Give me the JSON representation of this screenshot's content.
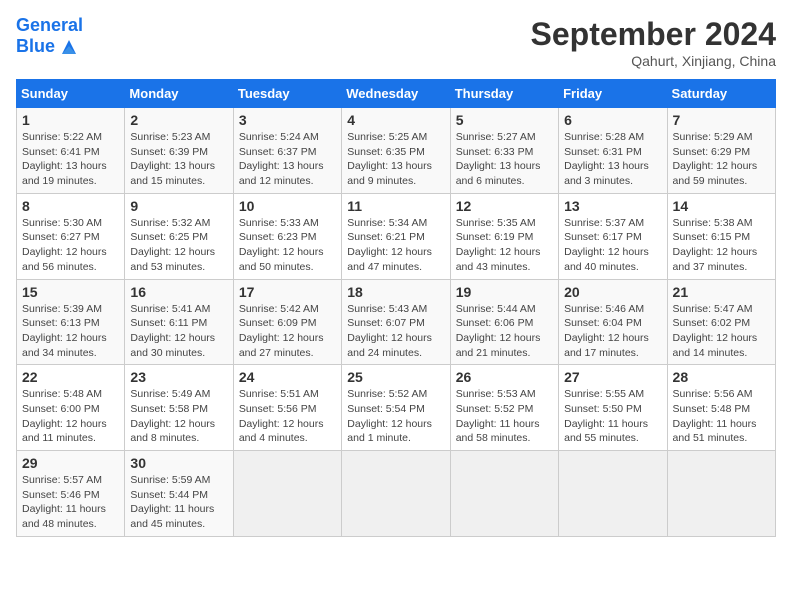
{
  "header": {
    "logo_line1": "General",
    "logo_line2": "Blue",
    "month": "September 2024",
    "location": "Qahurt, Xinjiang, China"
  },
  "days_of_week": [
    "Sunday",
    "Monday",
    "Tuesday",
    "Wednesday",
    "Thursday",
    "Friday",
    "Saturday"
  ],
  "weeks": [
    [
      {
        "day": "1",
        "sunrise": "5:22 AM",
        "sunset": "6:41 PM",
        "daylight": "13 hours and 19 minutes."
      },
      {
        "day": "2",
        "sunrise": "5:23 AM",
        "sunset": "6:39 PM",
        "daylight": "13 hours and 15 minutes."
      },
      {
        "day": "3",
        "sunrise": "5:24 AM",
        "sunset": "6:37 PM",
        "daylight": "13 hours and 12 minutes."
      },
      {
        "day": "4",
        "sunrise": "5:25 AM",
        "sunset": "6:35 PM",
        "daylight": "13 hours and 9 minutes."
      },
      {
        "day": "5",
        "sunrise": "5:27 AM",
        "sunset": "6:33 PM",
        "daylight": "13 hours and 6 minutes."
      },
      {
        "day": "6",
        "sunrise": "5:28 AM",
        "sunset": "6:31 PM",
        "daylight": "13 hours and 3 minutes."
      },
      {
        "day": "7",
        "sunrise": "5:29 AM",
        "sunset": "6:29 PM",
        "daylight": "12 hours and 59 minutes."
      }
    ],
    [
      {
        "day": "8",
        "sunrise": "5:30 AM",
        "sunset": "6:27 PM",
        "daylight": "12 hours and 56 minutes."
      },
      {
        "day": "9",
        "sunrise": "5:32 AM",
        "sunset": "6:25 PM",
        "daylight": "12 hours and 53 minutes."
      },
      {
        "day": "10",
        "sunrise": "5:33 AM",
        "sunset": "6:23 PM",
        "daylight": "12 hours and 50 minutes."
      },
      {
        "day": "11",
        "sunrise": "5:34 AM",
        "sunset": "6:21 PM",
        "daylight": "12 hours and 47 minutes."
      },
      {
        "day": "12",
        "sunrise": "5:35 AM",
        "sunset": "6:19 PM",
        "daylight": "12 hours and 43 minutes."
      },
      {
        "day": "13",
        "sunrise": "5:37 AM",
        "sunset": "6:17 PM",
        "daylight": "12 hours and 40 minutes."
      },
      {
        "day": "14",
        "sunrise": "5:38 AM",
        "sunset": "6:15 PM",
        "daylight": "12 hours and 37 minutes."
      }
    ],
    [
      {
        "day": "15",
        "sunrise": "5:39 AM",
        "sunset": "6:13 PM",
        "daylight": "12 hours and 34 minutes."
      },
      {
        "day": "16",
        "sunrise": "5:41 AM",
        "sunset": "6:11 PM",
        "daylight": "12 hours and 30 minutes."
      },
      {
        "day": "17",
        "sunrise": "5:42 AM",
        "sunset": "6:09 PM",
        "daylight": "12 hours and 27 minutes."
      },
      {
        "day": "18",
        "sunrise": "5:43 AM",
        "sunset": "6:07 PM",
        "daylight": "12 hours and 24 minutes."
      },
      {
        "day": "19",
        "sunrise": "5:44 AM",
        "sunset": "6:06 PM",
        "daylight": "12 hours and 21 minutes."
      },
      {
        "day": "20",
        "sunrise": "5:46 AM",
        "sunset": "6:04 PM",
        "daylight": "12 hours and 17 minutes."
      },
      {
        "day": "21",
        "sunrise": "5:47 AM",
        "sunset": "6:02 PM",
        "daylight": "12 hours and 14 minutes."
      }
    ],
    [
      {
        "day": "22",
        "sunrise": "5:48 AM",
        "sunset": "6:00 PM",
        "daylight": "12 hours and 11 minutes."
      },
      {
        "day": "23",
        "sunrise": "5:49 AM",
        "sunset": "5:58 PM",
        "daylight": "12 hours and 8 minutes."
      },
      {
        "day": "24",
        "sunrise": "5:51 AM",
        "sunset": "5:56 PM",
        "daylight": "12 hours and 4 minutes."
      },
      {
        "day": "25",
        "sunrise": "5:52 AM",
        "sunset": "5:54 PM",
        "daylight": "12 hours and 1 minute."
      },
      {
        "day": "26",
        "sunrise": "5:53 AM",
        "sunset": "5:52 PM",
        "daylight": "11 hours and 58 minutes."
      },
      {
        "day": "27",
        "sunrise": "5:55 AM",
        "sunset": "5:50 PM",
        "daylight": "11 hours and 55 minutes."
      },
      {
        "day": "28",
        "sunrise": "5:56 AM",
        "sunset": "5:48 PM",
        "daylight": "11 hours and 51 minutes."
      }
    ],
    [
      {
        "day": "29",
        "sunrise": "5:57 AM",
        "sunset": "5:46 PM",
        "daylight": "11 hours and 48 minutes."
      },
      {
        "day": "30",
        "sunrise": "5:59 AM",
        "sunset": "5:44 PM",
        "daylight": "11 hours and 45 minutes."
      },
      null,
      null,
      null,
      null,
      null
    ]
  ]
}
